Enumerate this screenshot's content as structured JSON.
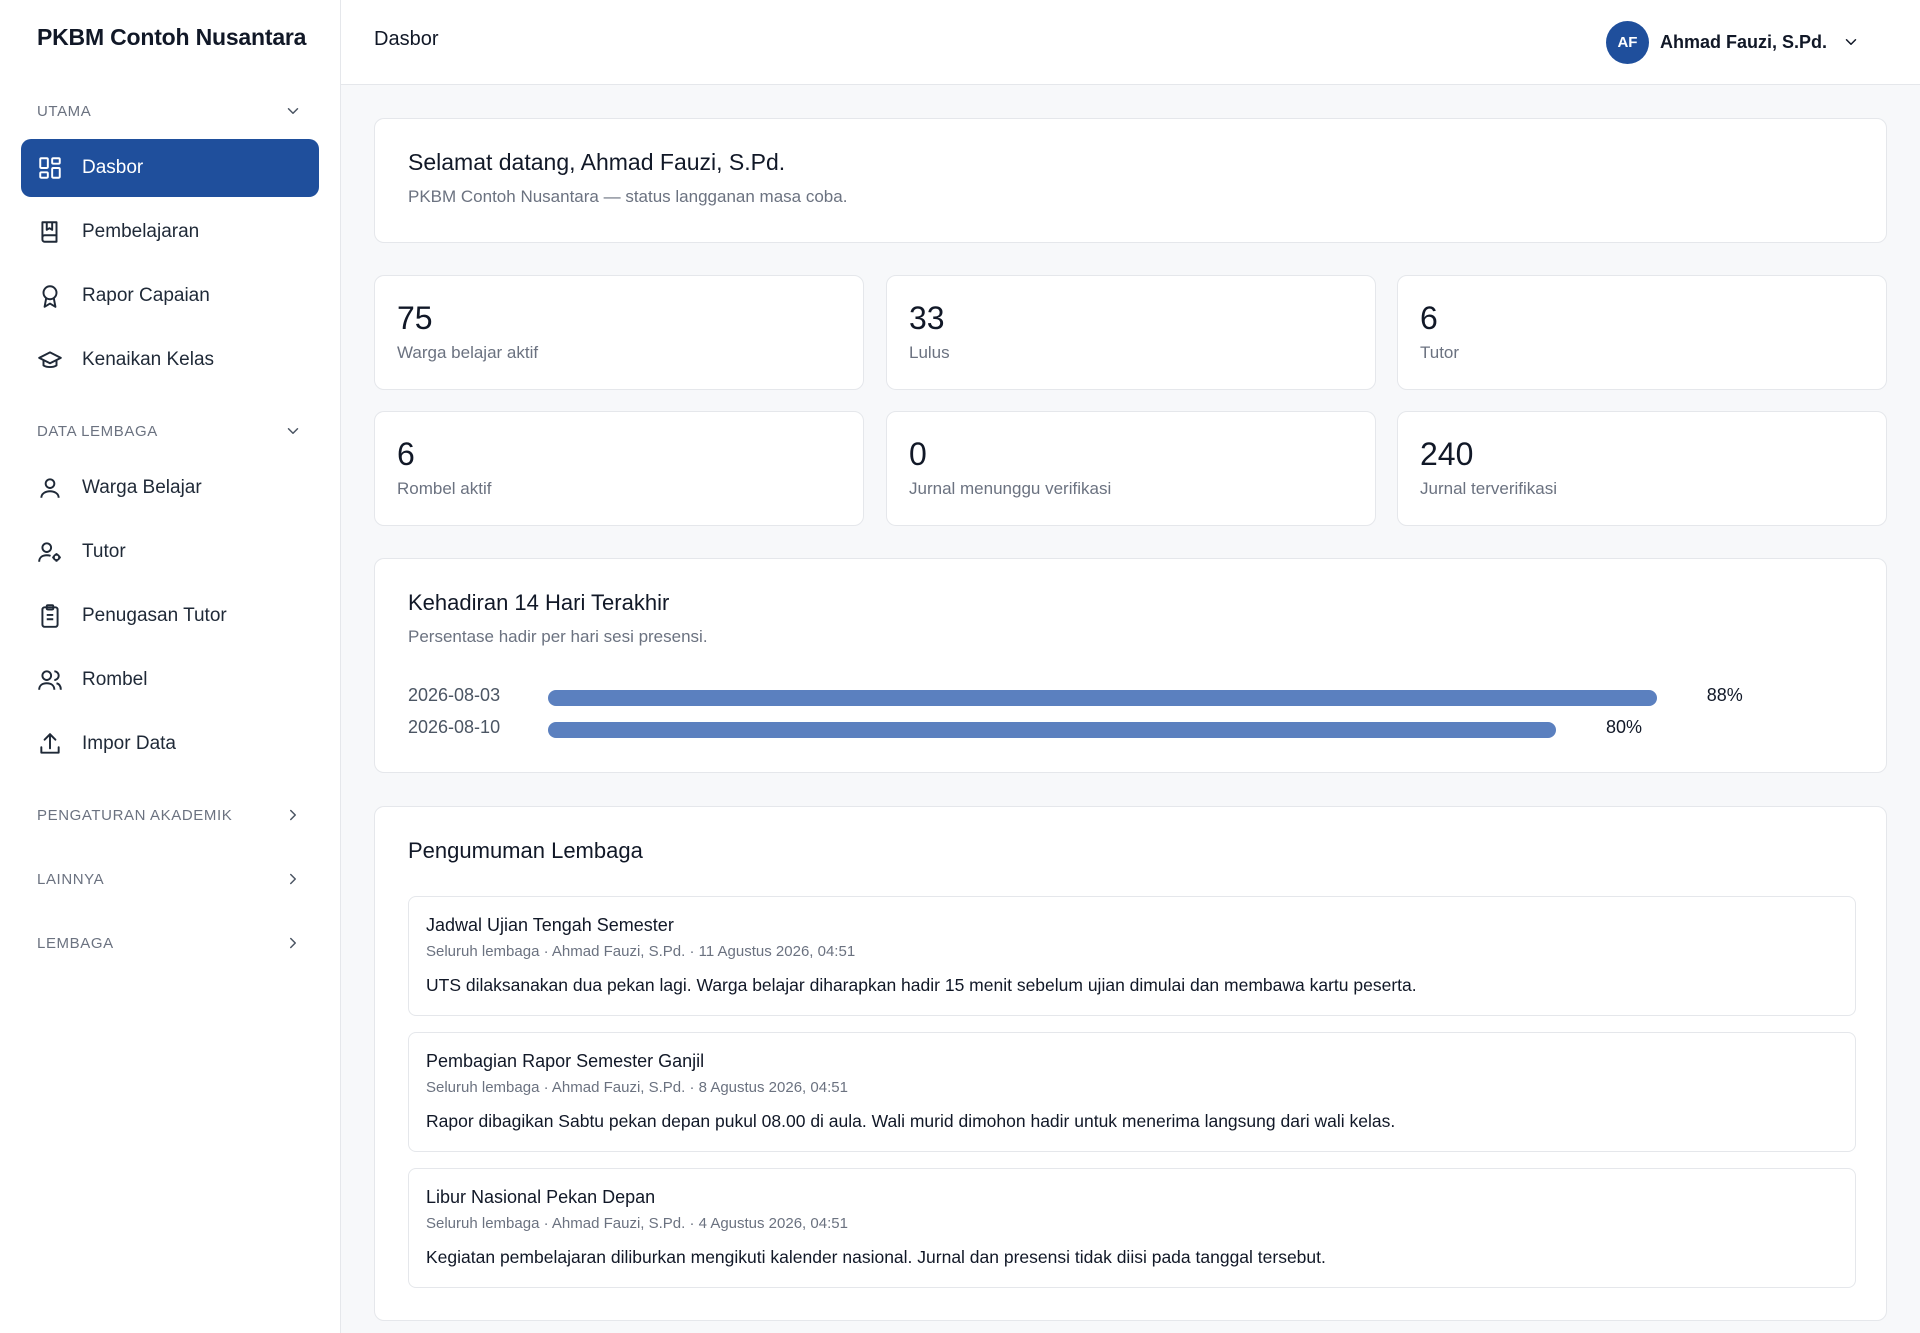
{
  "sidebar": {
    "brand": "PKBM Contoh Nusantara",
    "sections": {
      "utama": "UTAMA",
      "data_lembaga": "DATA LEMBAGA",
      "pengaturan_akademik": "PENGATURAN AKADEMIK",
      "lainnya": "LAINNYA",
      "lembaga": "LEMBAGA"
    },
    "items": {
      "dasbor": "Dasbor",
      "pembelajaran": "Pembelajaran",
      "rapor": "Rapor Capaian",
      "kenaikan": "Kenaikan Kelas",
      "warga": "Warga Belajar",
      "tutor": "Tutor",
      "penugasan": "Penugasan Tutor",
      "rombel": "Rombel",
      "impor": "Impor Data"
    },
    "active": "Dasbor",
    "accent_color": "#1f4f9c"
  },
  "header": {
    "title": "Dasbor",
    "user_initials": "AF",
    "user_name": "Ahmad Fauzi, S.Pd."
  },
  "welcome": {
    "title": "Selamat datang, Ahmad Fauzi, S.Pd.",
    "subtitle": "PKBM Contoh Nusantara — status langganan masa coba."
  },
  "stats": [
    {
      "value": "75",
      "label": "Warga belajar aktif"
    },
    {
      "value": "33",
      "label": "Lulus"
    },
    {
      "value": "6",
      "label": "Tutor"
    },
    {
      "value": "6",
      "label": "Rombel aktif"
    },
    {
      "value": "0",
      "label": "Jurnal menunggu verifikasi"
    },
    {
      "value": "240",
      "label": "Jurnal terverifikasi"
    }
  ],
  "attendance": {
    "title": "Kehadiran 14 Hari Terakhir",
    "subtitle": "Persentase hadir per hari sesi presensi.",
    "bar_color": "#5b80bf",
    "rows": [
      {
        "date": "2026-08-03",
        "percent": 88,
        "label": "88%"
      },
      {
        "date": "2026-08-10",
        "percent": 80,
        "label": "80%"
      }
    ]
  },
  "announcements": {
    "title": "Pengumuman Lembaga",
    "items": [
      {
        "title": "Jadwal Ujian Tengah Semester",
        "meta": "Seluruh lembaga · Ahmad Fauzi, S.Pd. · 11 Agustus 2026, 04:51",
        "body": "UTS dilaksanakan dua pekan lagi. Warga belajar diharapkan hadir 15 menit sebelum ujian dimulai dan membawa kartu peserta."
      },
      {
        "title": "Pembagian Rapor Semester Ganjil",
        "meta": "Seluruh lembaga · Ahmad Fauzi, S.Pd. · 8 Agustus 2026, 04:51",
        "body": "Rapor dibagikan Sabtu pekan depan pukul 08.00 di aula. Wali murid dimohon hadir untuk menerima langsung dari wali kelas."
      },
      {
        "title": "Libur Nasional Pekan Depan",
        "meta": "Seluruh lembaga · Ahmad Fauzi, S.Pd. · 4 Agustus 2026, 04:51",
        "body": "Kegiatan pembelajaran diliburkan mengikuti kalender nasional. Jurnal dan presensi tidak diisi pada tanggal tersebut."
      }
    ]
  }
}
